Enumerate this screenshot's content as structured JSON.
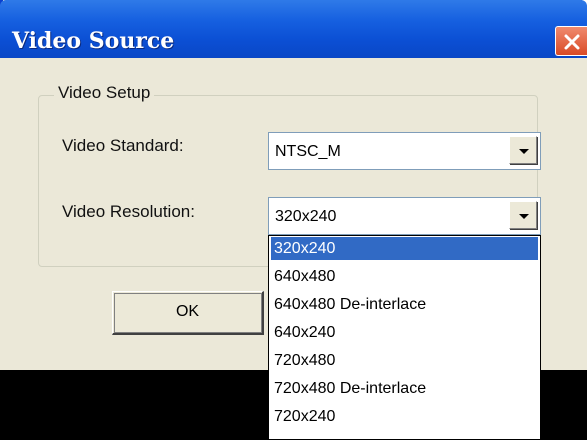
{
  "window": {
    "title": "Video Source"
  },
  "group": {
    "title": "Video Setup"
  },
  "standard": {
    "label": "Video Standard:",
    "value": "NTSC_M"
  },
  "resolution": {
    "label": "Video Resolution:",
    "value": "320x240",
    "options": [
      "320x240",
      "640x480",
      "640x480 De-interlace",
      "640x240",
      "720x480",
      "720x480 De-interlace",
      "720x240"
    ]
  },
  "buttons": {
    "ok": "OK"
  },
  "colors": {
    "titlebar": "#0b4fd4",
    "selection": "#316ac5",
    "close": "#d94a26"
  }
}
